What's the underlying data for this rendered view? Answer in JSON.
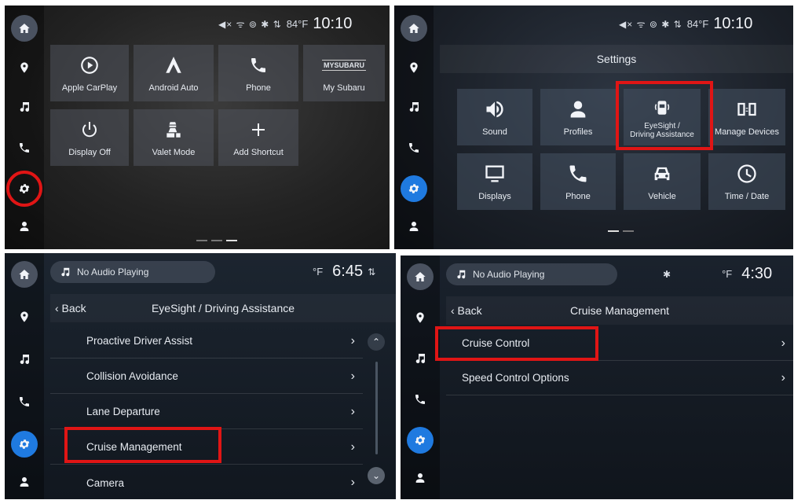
{
  "panel1": {
    "status": {
      "glyphs": "◀× ᯤ ⊚ ✱  ⇅",
      "temp": "84°F",
      "time": "10:10"
    },
    "tiles": [
      {
        "label": "Apple CarPlay",
        "icon": "carplay-icon"
      },
      {
        "label": "Android Auto",
        "icon": "android-auto-icon"
      },
      {
        "label": "Phone",
        "icon": "phone-icon"
      },
      {
        "label": "My Subaru",
        "icon": "mysubaru-logo",
        "logo_text": "MYSUBARU"
      },
      {
        "label": "Display Off",
        "icon": "power-icon"
      },
      {
        "label": "Valet Mode",
        "icon": "valet-icon"
      },
      {
        "label": "Add Shortcut",
        "icon": "plus-icon"
      }
    ]
  },
  "panel2": {
    "status": {
      "glyphs": "◀× ᯤ ⊚ ✱  ⇅",
      "temp": "84°F",
      "time": "10:10"
    },
    "title": "Settings",
    "tiles": [
      {
        "label": "Sound",
        "icon": "speaker-icon"
      },
      {
        "label": "Profiles",
        "icon": "profile-icon"
      },
      {
        "label": "EyeSight / Driving Assistance",
        "line1": "EyeSight /",
        "line2": "Driving Assistance",
        "icon": "eyesight-icon"
      },
      {
        "label": "Manage Devices",
        "icon": "devices-icon"
      },
      {
        "label": "Displays",
        "icon": "display-icon"
      },
      {
        "label": "Phone",
        "icon": "phone-icon"
      },
      {
        "label": "Vehicle",
        "icon": "car-icon"
      },
      {
        "label": "Time / Date",
        "icon": "clock-icon"
      }
    ]
  },
  "panel3": {
    "audio": "No Audio Playing",
    "temp": "°F",
    "time": "6:45",
    "back": "‹ Back",
    "title": "EyeSight / Driving Assistance",
    "rows": [
      "Proactive Driver Assist",
      "Collision Avoidance",
      "Lane Departure",
      "Cruise Management",
      "Camera"
    ],
    "chevron": "›"
  },
  "panel4": {
    "audio": "No Audio Playing",
    "bt": "✱",
    "temp": "°F",
    "time": "4:30",
    "back": "‹ Back",
    "title": "Cruise Management",
    "rows": [
      "Cruise Control",
      "Speed Control Options"
    ],
    "chevron": "›"
  },
  "colors": {
    "highlight_red": "#e01515",
    "active_blue": "#1f7ae0"
  }
}
